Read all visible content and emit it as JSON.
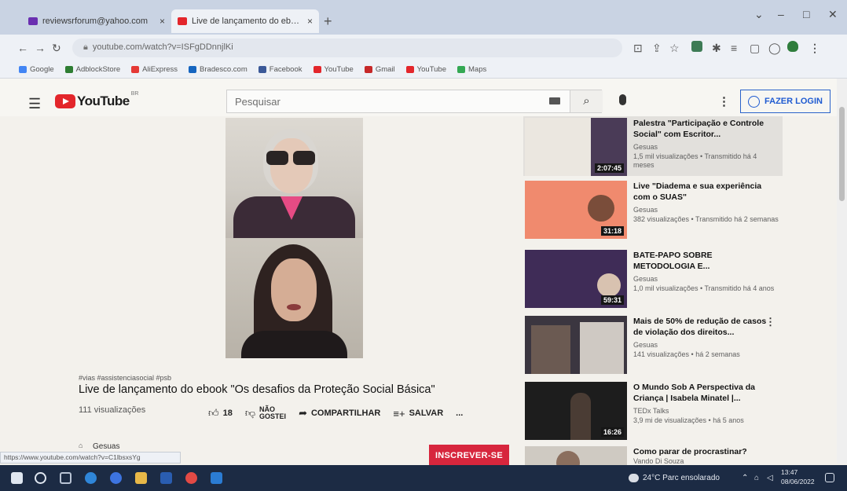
{
  "browser": {
    "tabs": [
      {
        "title": "reviewsrforum@yahoo.com",
        "close": "×"
      },
      {
        "title": "Live de lançamento do ebook",
        "close": "×"
      }
    ],
    "new_tab": "+",
    "url": "youtube.com/watch?v=ISFgDDnnjlKi",
    "bookmarks": [
      {
        "label": "Google",
        "color": "#4285f4"
      },
      {
        "label": "AdblockStore",
        "color": "#2e7d32"
      },
      {
        "label": "AliExpress",
        "color": "#e53935"
      },
      {
        "label": "Bradesco.com",
        "color": "#1565c0"
      },
      {
        "label": "Facebook",
        "color": "#3b5998"
      },
      {
        "label": "YouTube",
        "color": "#e3262b"
      },
      {
        "label": "Gmail",
        "color": "#c62828"
      },
      {
        "label": "YouTube",
        "color": "#e3262b"
      },
      {
        "label": "Maps",
        "color": "#34a853"
      }
    ]
  },
  "youtube": {
    "logo_text": "YouTube",
    "logo_country": "BR",
    "search_placeholder": "Pesquisar",
    "login_label": "FAZER LOGIN"
  },
  "video": {
    "hashtags": "#vias #assistenciasocial #psb",
    "title": "Live de lançamento do ebook \"Os desafios da Proteção Social Básica\"",
    "views": "111 visualizações",
    "likes": "18",
    "dislike_label_1": "NÃO",
    "dislike_label_2": "GOSTEI",
    "share_label": "COMPARTILHAR",
    "save_label": "SALVAR",
    "more": "...",
    "channel": "Gesuas",
    "subscribe_label": "INSCREVER-SE"
  },
  "status_url": "https://www.youtube.com/watch?v=C1lbsxsYg",
  "related": [
    {
      "title": "Palestra \"Participação e Controle Social\" com Escritor...",
      "channel": "Gesuas",
      "meta": "1,5 mil visualizações • Transmitido há 4 meses",
      "duration": "2:07:45",
      "thumb_color": "#ebe7e0"
    },
    {
      "title": "Live \"Diadema e sua experiência com o SUAS\"",
      "channel": "Gesuas",
      "meta": "382 visualizações • Transmitido há 2 semanas",
      "duration": "31:18",
      "thumb_color": "#f08a6e"
    },
    {
      "title": "BATE-PAPO SOBRE METODOLOGIA E...",
      "channel": "Gesuas",
      "meta": "1,0 mil visualizações • Transmitido há 4 anos",
      "duration": "59:31",
      "thumb_color": "#3f2c57"
    },
    {
      "title": "Mais de 50% de redução de casos de violação dos direitos...",
      "channel": "Gesuas",
      "meta": "141 visualizações • há 2 semanas",
      "duration": "",
      "thumb_color": "#3b3640"
    },
    {
      "title": "O Mundo Sob A Perspectiva da Criança | Isabela Minatel |...",
      "channel": "TEDx Talks",
      "meta": "3,9 mi de visualizações • há 5 anos",
      "duration": "16:26",
      "thumb_color": "#1d1d1d"
    },
    {
      "title": "Como parar de procrastinar?",
      "channel": "Vando Di Souza",
      "meta": "",
      "duration": "",
      "thumb_color": "#cfcac2"
    }
  ],
  "taskbar": {
    "weather": "24°C Parc ensolarado",
    "time": "13:47",
    "date": "08/06/2022"
  }
}
